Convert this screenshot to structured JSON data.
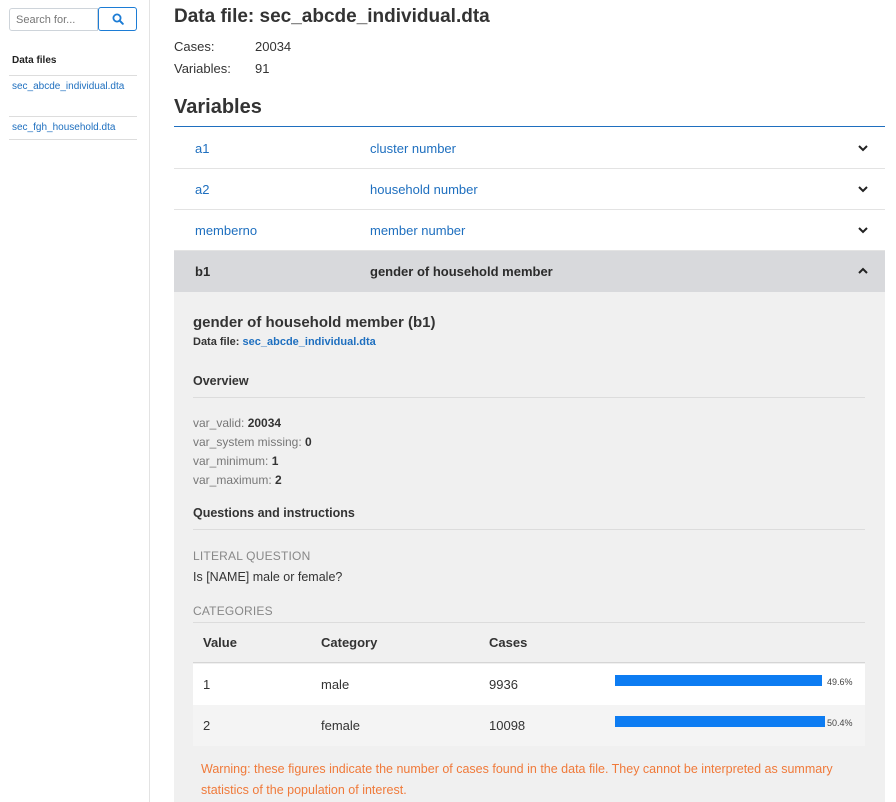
{
  "sidebar": {
    "search_placeholder": "Search for...",
    "heading": "Data files",
    "files": [
      {
        "label": "sec_abcde_individual.dta"
      },
      {
        "label": "sec_fgh_household.dta"
      }
    ]
  },
  "header": {
    "title": "Data file: sec_abcde_individual.dta",
    "cases_label": "Cases:",
    "cases_value": "20034",
    "variables_label": "Variables:",
    "variables_value": "91"
  },
  "variables_title": "Variables",
  "variables": [
    {
      "name": "a1",
      "label": "cluster number"
    },
    {
      "name": "a2",
      "label": "household number"
    },
    {
      "name": "memberno",
      "label": "member number"
    },
    {
      "name": "b1",
      "label": "gender of household member"
    }
  ],
  "detail": {
    "title": "gender of household member (b1)",
    "file_label": "Data file:",
    "file_link": "sec_abcde_individual.dta",
    "overview_heading": "Overview",
    "stats": [
      {
        "label": "var_valid:",
        "value": "20034"
      },
      {
        "label": "var_system missing:",
        "value": "0"
      },
      {
        "label": "var_minimum:",
        "value": "1"
      },
      {
        "label": "var_maximum:",
        "value": "2"
      }
    ],
    "questions_heading": "Questions and instructions",
    "literal_question_label": "LITERAL QUESTION",
    "literal_question_text": "Is [NAME] male or female?",
    "categories_label": "CATEGORIES",
    "table_headers": {
      "value": "Value",
      "category": "Category",
      "cases": "Cases"
    },
    "categories": [
      {
        "value": "1",
        "category": "male",
        "cases": "9936",
        "percent": "49.6%",
        "fraction": 0.496
      },
      {
        "value": "2",
        "category": "female",
        "cases": "10098",
        "percent": "50.4%",
        "fraction": 0.504
      }
    ],
    "warning": "Warning: these figures indicate the number of cases found in the data file. They cannot be interpreted as summary statistics of the population of interest."
  },
  "colors": {
    "link": "#1e6fbf",
    "bar": "#0d7cf2",
    "warning": "#f07a3a"
  },
  "icons": {
    "search": "search-icon",
    "expand": "chevron-down-icon",
    "collapse": "chevron-up-icon"
  }
}
